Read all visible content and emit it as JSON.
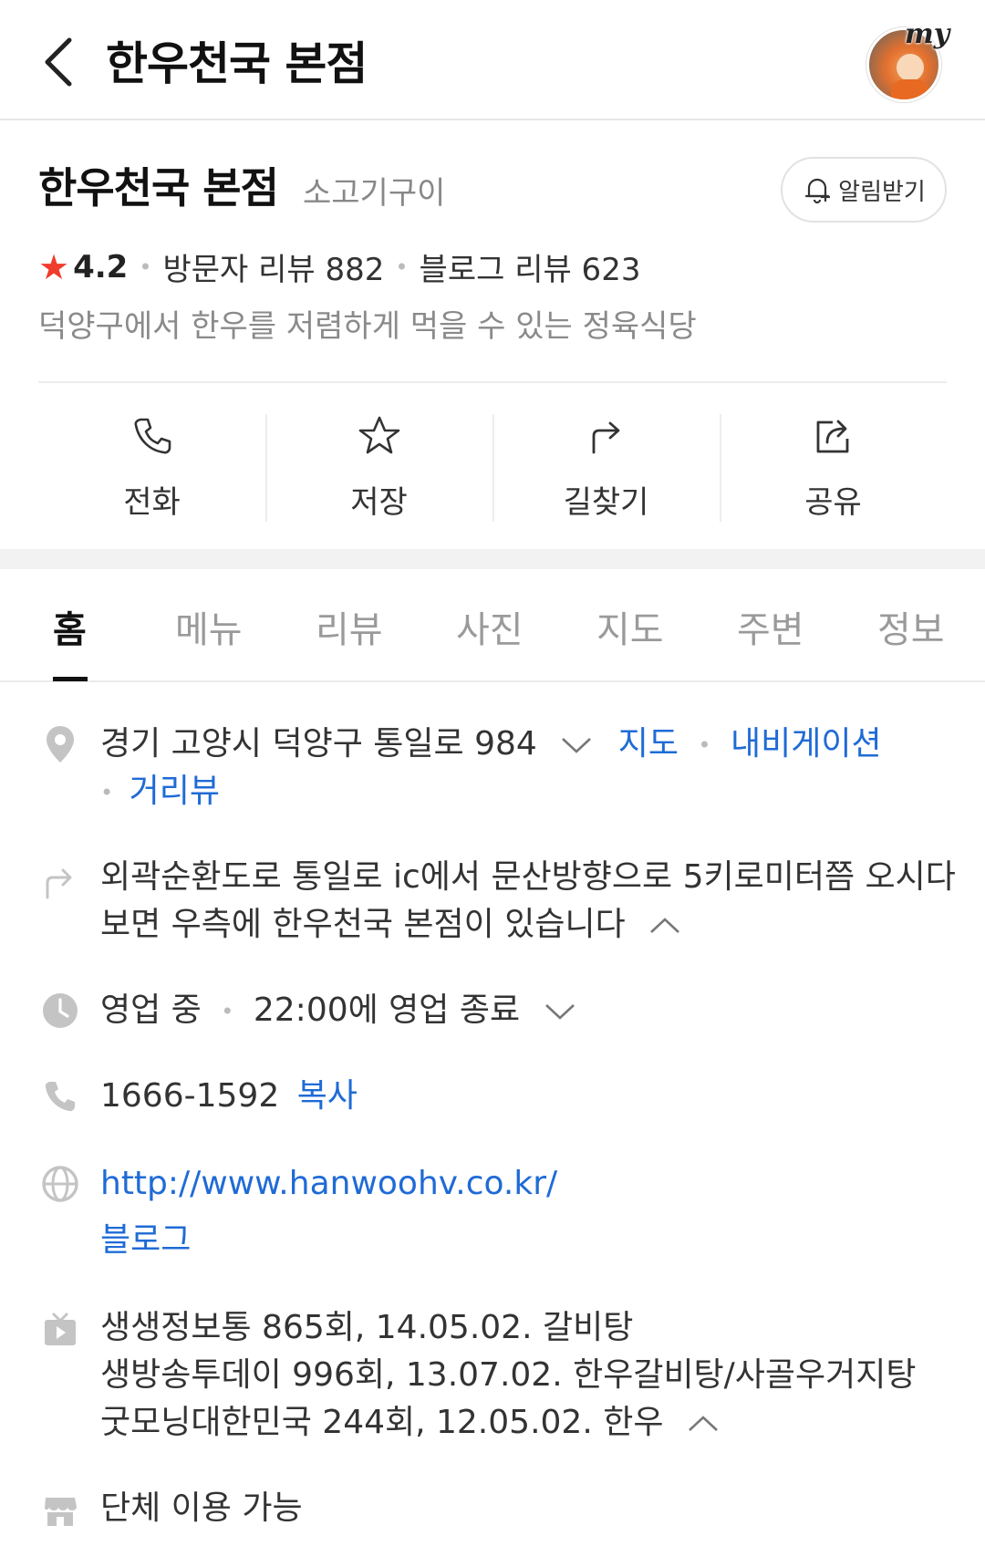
{
  "header": {
    "title": "한우천국 본점",
    "avatar_badge": "my"
  },
  "place": {
    "name": "한우천국 본점",
    "category": "소고기구이",
    "alarm_label": "알림받기",
    "rating": "4.2",
    "visitor_review": "방문자 리뷰 882",
    "blog_review": "블로그 리뷰 623",
    "description": "덕양구에서 한우를 저렴하게 먹을 수 있는 정육식당"
  },
  "actions": [
    {
      "label": "전화",
      "icon": "phone-icon"
    },
    {
      "label": "저장",
      "icon": "star-icon"
    },
    {
      "label": "길찾기",
      "icon": "directions-icon"
    },
    {
      "label": "공유",
      "icon": "share-icon"
    }
  ],
  "tabs": [
    "홈",
    "메뉴",
    "리뷰",
    "사진",
    "지도",
    "주변",
    "정보"
  ],
  "info": {
    "address": "경기 고양시 덕양구 통일로 984",
    "map_link": "지도",
    "navigation_link": "내비게이션",
    "streetview_link": "거리뷰",
    "directions_line1": "외곽순환도로 통일로 ic에서 문산방향으로 5키로미터쯤 오시다",
    "directions_line2": "보면 우측에 한우천국 본점이 있습니다",
    "hours_status": "영업 중",
    "hours_detail": "22:00에 영업 종료",
    "phone": "1666-1592",
    "copy_label": "복사",
    "website": "http://www.hanwoohv.co.kr/",
    "blog_link": "블로그",
    "tv": [
      "생생정보통 865회, 14.05.02. 갈비탕",
      "생방송투데이 996회, 13.07.02. 한우갈비탕/사골우거지탕",
      "굿모닝대한민국 244회, 12.05.02. 한우"
    ],
    "group": "단체 이용 가능"
  },
  "colors": {
    "link": "#1f6bd6",
    "star": "#f03c2c",
    "muted": "#8a8a8a"
  }
}
